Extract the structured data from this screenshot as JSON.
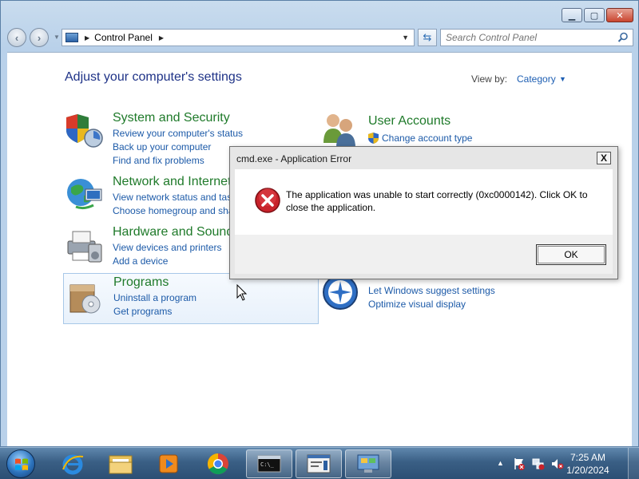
{
  "window": {
    "caption_buttons": {
      "minimize": "▁",
      "maximize": "▢",
      "close": "✕"
    }
  },
  "address_bar": {
    "path": "Control Panel",
    "icon": "control-panel-icon"
  },
  "search": {
    "placeholder": "Search Control Panel"
  },
  "page": {
    "heading": "Adjust your computer's settings",
    "view_by_label": "View by:",
    "view_by_value": "Category"
  },
  "categories": {
    "system_security": {
      "title": "System and Security",
      "links": [
        "Review your computer's status",
        "Back up your computer",
        "Find and fix problems"
      ]
    },
    "network_internet": {
      "title": "Network and Internet",
      "links": [
        "View network status and tasks",
        "Choose homegroup and sharing options"
      ]
    },
    "hardware_sound": {
      "title": "Hardware and Sound",
      "links": [
        "View devices and printers",
        "Add a device"
      ]
    },
    "programs": {
      "title": "Programs",
      "links": [
        "Uninstall a program",
        "Get programs"
      ]
    },
    "user_accounts": {
      "title": "User Accounts",
      "links": [
        "Change account type"
      ]
    },
    "ease_of_access": {
      "links": [
        "Let Windows suggest settings",
        "Optimize visual display"
      ]
    }
  },
  "dialog": {
    "title": "cmd.exe - Application Error",
    "close_label": "X",
    "message": "The application was unable to start correctly (0xc0000142). Click OK to close the application.",
    "ok_label": "OK"
  },
  "taskbar": {
    "time": "7:25 AM",
    "date": "1/20/2024"
  },
  "colors": {
    "link": "#1c5aa8",
    "category_title": "#1f7a2a",
    "heading": "#1e3287",
    "error_red": "#c8222a"
  }
}
